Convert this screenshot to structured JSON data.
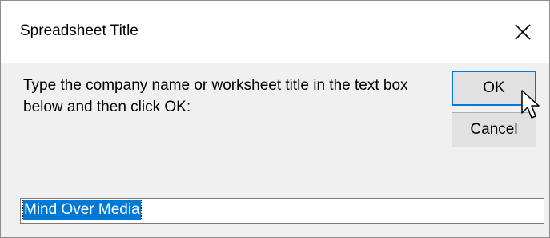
{
  "dialog": {
    "title": "Spreadsheet Title",
    "prompt": "Type the company name or worksheet title in the text box below and then click OK:",
    "ok_label": "OK",
    "cancel_label": "Cancel",
    "input_value": "Mind Over Media",
    "close_icon": "close-icon",
    "cursor_icon": "mouse-pointer-icon"
  },
  "colors": {
    "selection": "#0078d7",
    "dialog_bg": "#f0f0f0",
    "title_bg": "#ffffff"
  }
}
